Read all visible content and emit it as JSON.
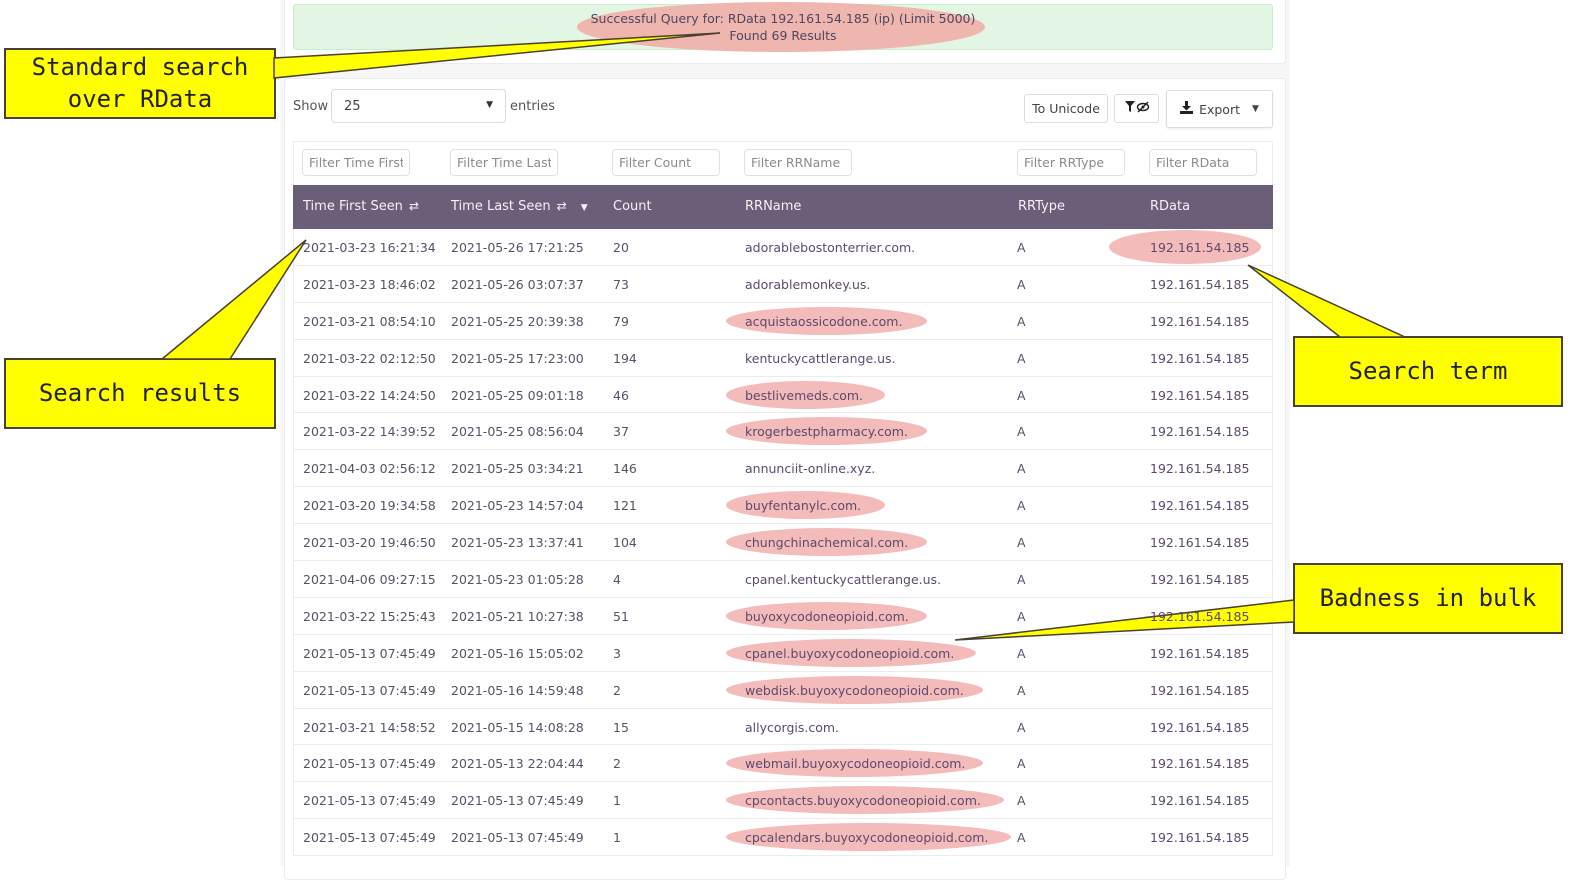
{
  "alert": {
    "line1": "Successful Query for: RData 192.161.54.185 (ip) (Limit 5000)",
    "line2": "Found 69 Results",
    "color": "#e3f6e3"
  },
  "length_menu": {
    "show_label": "Show",
    "selected": "25",
    "entries_label": "entries"
  },
  "toolbar": {
    "unicode_label": "To Unicode",
    "filter_toggle_icon": "filter-eye-slash-icon",
    "export_label": "Export",
    "export_icon": "download-icon"
  },
  "filters": [
    {
      "placeholder": "Filter Time First"
    },
    {
      "placeholder": "Filter Time Last"
    },
    {
      "placeholder": "Filter Count"
    },
    {
      "placeholder": "Filter RRName"
    },
    {
      "placeholder": "Filter RRType"
    },
    {
      "placeholder": "Filter RData"
    }
  ],
  "table": {
    "header_color": "#6b5e78",
    "columns": [
      "Time First Seen",
      "Time Last Seen",
      "Count",
      "RRName",
      "RRType",
      "RData"
    ],
    "sort_glyph": "⇄",
    "rows": [
      {
        "first": "2021-03-23 16:21:34",
        "last": "2021-05-26 17:21:25",
        "count": "20",
        "rrname": "adorablebostonterrier.com.",
        "rrtype": "A",
        "rdata": "192.161.54.185",
        "flagged": false
      },
      {
        "first": "2021-03-23 18:46:02",
        "last": "2021-05-26 03:07:37",
        "count": "73",
        "rrname": "adorablemonkey.us.",
        "rrtype": "A",
        "rdata": "192.161.54.185",
        "flagged": false
      },
      {
        "first": "2021-03-21 08:54:10",
        "last": "2021-05-25 20:39:38",
        "count": "79",
        "rrname": "acquistaossicodone.com.",
        "rrtype": "A",
        "rdata": "192.161.54.185",
        "flagged": true
      },
      {
        "first": "2021-03-22 02:12:50",
        "last": "2021-05-25 17:23:00",
        "count": "194",
        "rrname": "kentuckycattlerange.us.",
        "rrtype": "A",
        "rdata": "192.161.54.185",
        "flagged": false
      },
      {
        "first": "2021-03-22 14:24:50",
        "last": "2021-05-25 09:01:18",
        "count": "46",
        "rrname": "bestlivemeds.com.",
        "rrtype": "A",
        "rdata": "192.161.54.185",
        "flagged": true
      },
      {
        "first": "2021-03-22 14:39:52",
        "last": "2021-05-25 08:56:04",
        "count": "37",
        "rrname": "krogerbestpharmacy.com.",
        "rrtype": "A",
        "rdata": "192.161.54.185",
        "flagged": true
      },
      {
        "first": "2021-04-03 02:56:12",
        "last": "2021-05-25 03:34:21",
        "count": "146",
        "rrname": "annunciit-online.xyz.",
        "rrtype": "A",
        "rdata": "192.161.54.185",
        "flagged": false
      },
      {
        "first": "2021-03-20 19:34:58",
        "last": "2021-05-23 14:57:04",
        "count": "121",
        "rrname": "buyfentanylc.com.",
        "rrtype": "A",
        "rdata": "192.161.54.185",
        "flagged": true
      },
      {
        "first": "2021-03-20 19:46:50",
        "last": "2021-05-23 13:37:41",
        "count": "104",
        "rrname": "chungchinachemical.com.",
        "rrtype": "A",
        "rdata": "192.161.54.185",
        "flagged": true
      },
      {
        "first": "2021-04-06 09:27:15",
        "last": "2021-05-23 01:05:28",
        "count": "4",
        "rrname": "cpanel.kentuckycattlerange.us.",
        "rrtype": "A",
        "rdata": "192.161.54.185",
        "flagged": false
      },
      {
        "first": "2021-03-22 15:25:43",
        "last": "2021-05-21 10:27:38",
        "count": "51",
        "rrname": "buyoxycodoneopioid.com.",
        "rrtype": "A",
        "rdata": "192.161.54.185",
        "flagged": true
      },
      {
        "first": "2021-05-13 07:45:49",
        "last": "2021-05-16 15:05:02",
        "count": "3",
        "rrname": "cpanel.buyoxycodoneopioid.com.",
        "rrtype": "A",
        "rdata": "192.161.54.185",
        "flagged": true
      },
      {
        "first": "2021-05-13 07:45:49",
        "last": "2021-05-16 14:59:48",
        "count": "2",
        "rrname": "webdisk.buyoxycodoneopioid.com.",
        "rrtype": "A",
        "rdata": "192.161.54.185",
        "flagged": true
      },
      {
        "first": "2021-03-21 14:58:52",
        "last": "2021-05-15 14:08:28",
        "count": "15",
        "rrname": "allycorgis.com.",
        "rrtype": "A",
        "rdata": "192.161.54.185",
        "flagged": false
      },
      {
        "first": "2021-05-13 07:45:49",
        "last": "2021-05-13 22:04:44",
        "count": "2",
        "rrname": "webmail.buyoxycodoneopioid.com.",
        "rrtype": "A",
        "rdata": "192.161.54.185",
        "flagged": true
      },
      {
        "first": "2021-05-13 07:45:49",
        "last": "2021-05-13 07:45:49",
        "count": "1",
        "rrname": "cpcontacts.buyoxycodoneopioid.com.",
        "rrtype": "A",
        "rdata": "192.161.54.185",
        "flagged": true
      },
      {
        "first": "2021-05-13 07:45:49",
        "last": "2021-05-13 07:45:49",
        "count": "1",
        "rrname": "cpcalendars.buyoxycodoneopioid.com.",
        "rrtype": "A",
        "rdata": "192.161.54.185",
        "flagged": true
      }
    ]
  },
  "annotations": {
    "standard_search": "Standard search over RData",
    "search_results": "Search results",
    "search_term": "Search term",
    "badness": "Badness in bulk",
    "callout_color": "#ffff00",
    "highlight_color": "#f3b4b4"
  }
}
